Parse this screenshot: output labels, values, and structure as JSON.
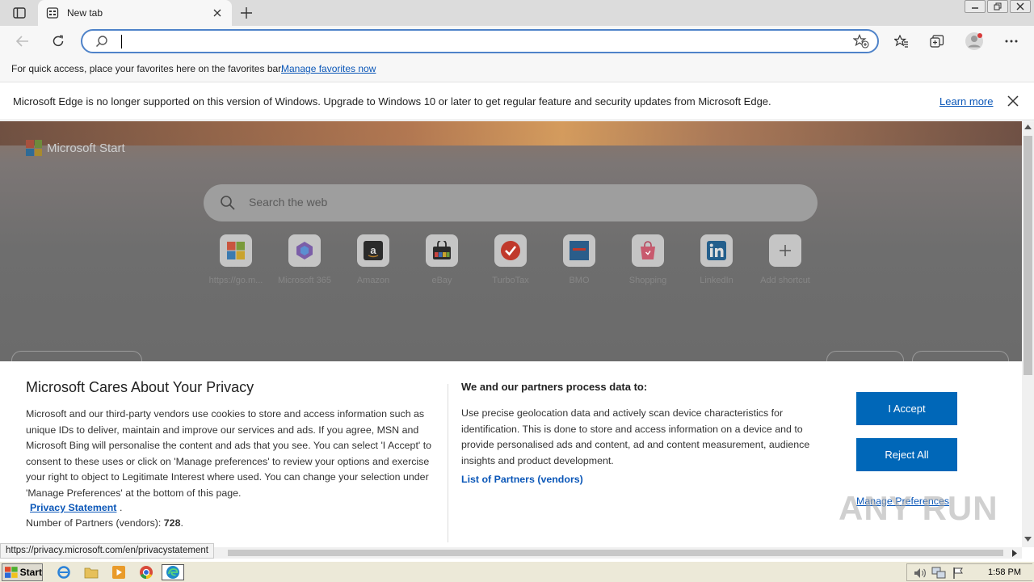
{
  "browser": {
    "tab_title": "New tab",
    "favorites_bar_text": "For quick access, place your favorites here on the favorites bar.",
    "favorites_bar_link": "Manage favorites now",
    "infobar_message": "Microsoft Edge is no longer supported on this version of Windows. Upgrade to Windows 10 or later to get regular feature and security updates from Microsoft Edge.",
    "infobar_link": "Learn more",
    "address_value": "",
    "status_url": "https://privacy.microsoft.com/en/privacystatement"
  },
  "newtab": {
    "brand": "Microsoft Start",
    "search_placeholder": "Search the web",
    "shortcuts": [
      {
        "label": "https://go.m...",
        "icon": "windows-icon"
      },
      {
        "label": "Microsoft 365",
        "icon": "m365-icon"
      },
      {
        "label": "Amazon",
        "icon": "amazon-icon"
      },
      {
        "label": "eBay",
        "icon": "ebay-icon"
      },
      {
        "label": "TurboTax",
        "icon": "turbotax-icon"
      },
      {
        "label": "BMO",
        "icon": "bmo-icon"
      },
      {
        "label": "Shopping",
        "icon": "shopping-icon"
      },
      {
        "label": "LinkedIn",
        "icon": "linkedin-icon"
      },
      {
        "label": "Add shortcut",
        "icon": "plus-icon"
      }
    ]
  },
  "privacy": {
    "title": "Microsoft Cares About Your Privacy",
    "body": "Microsoft and our third-party vendors use cookies to store and access information such as unique IDs to deliver, maintain and improve our services and ads. If you agree, MSN and Microsoft Bing will personalise the content and ads that you see. You can select 'I Accept' to consent to these uses or click on 'Manage preferences' to review your options and exercise your right to object to Legitimate Interest where used.  You can change your selection under 'Manage Preferences' at the bottom of this page.",
    "statement_link": "Privacy Statement",
    "statement_dot": ".",
    "partners_label": "Number of Partners (vendors): ",
    "partners_count": "728",
    "partners_end": ".",
    "process_title": "We and our partners process data to:",
    "process_body": "Use precise geolocation data and actively scan device characteristics for identification. This is done to store and access information on a device and to provide personalised ads and content, ad and content measurement, audience insights and product development.",
    "vendors_link": "List of Partners (vendors)",
    "accept": "I Accept",
    "reject": "Reject All",
    "manage": "Manage Preferences"
  },
  "watermark": "ANY RUN",
  "taskbar": {
    "start": "Start",
    "clock": "1:58 PM"
  },
  "colors": {
    "accent": "#0067b8",
    "link": "#0b57b8",
    "address_border": "#4f83c9"
  }
}
